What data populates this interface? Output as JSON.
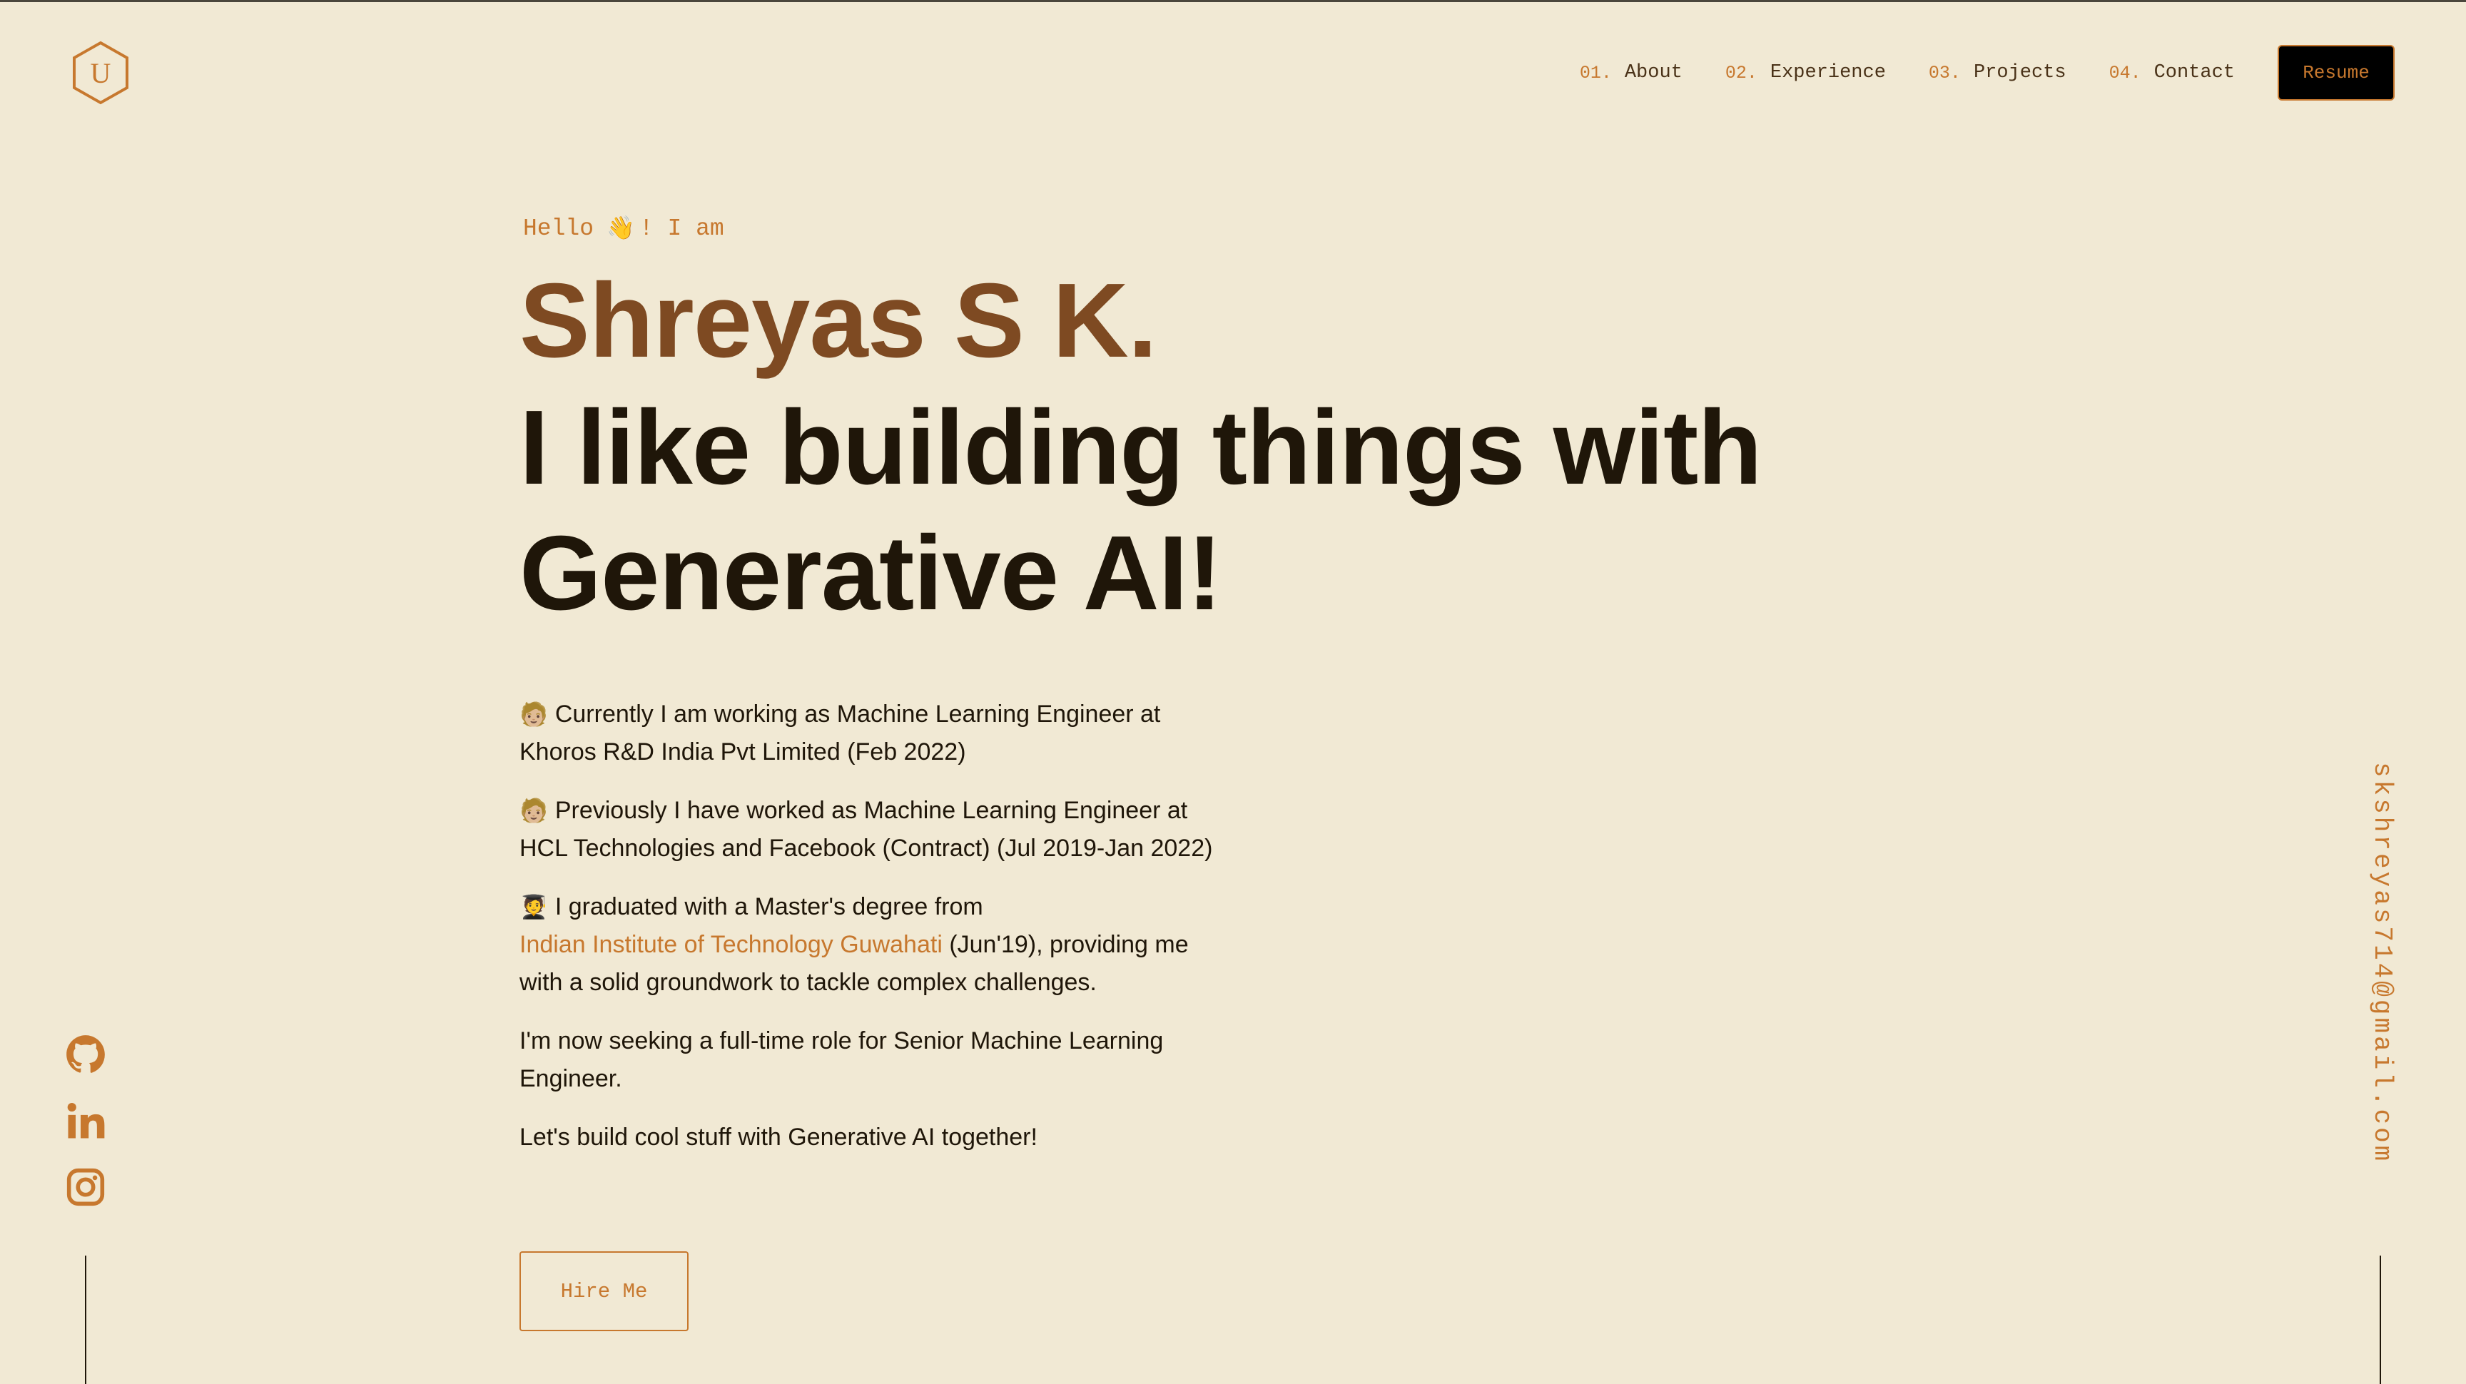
{
  "logo": {
    "letter": "U"
  },
  "nav": {
    "items": [
      {
        "num": "01.",
        "label": "About"
      },
      {
        "num": "02.",
        "label": "Experience"
      },
      {
        "num": "03.",
        "label": "Projects"
      },
      {
        "num": "04.",
        "label": "Contact"
      }
    ],
    "resume_label": "Resume"
  },
  "hero": {
    "greeting_pre": "Hello",
    "wave_icon": "👋",
    "greeting_post": "! I am",
    "name": "Shreyas S K.",
    "tagline_line1": "I like building things with",
    "tagline_line2": "Generative AI!"
  },
  "bio": {
    "p1_emoji": "🧑🏼",
    "p1_line1": "Currently I am working as Machine Learning Engineer at",
    "p1_line2": "Khoros R&D India Pvt Limited (Feb 2022)",
    "p2_emoji": "🧑🏼",
    "p2_line1": "Previously I have worked as Machine Learning Engineer at",
    "p2_line2": "HCL Technologies and Facebook (Contract) (Jul 2019-Jan 2022)",
    "p3_emoji": "🧑‍🎓",
    "p3_line1": "I graduated with a Master's degree from",
    "p3_link": "Indian Institute of Technology Guwahati",
    "p3_after_link": " (Jun'19), providing me",
    "p3_line3": "with a solid groundwork to tackle complex challenges.",
    "p4_line1": "I'm now seeking a full-time role for Senior Machine Learning",
    "p4_line2": "Engineer.",
    "p5": "Let's build cool stuff with Generative AI together!"
  },
  "hire_label": "Hire Me",
  "social": {
    "icons": [
      "github-icon",
      "linkedin-icon",
      "instagram-icon"
    ]
  },
  "email": "skshreyas714@gmail.com",
  "colors": {
    "accent": "#c7782e",
    "name": "#7e4a22",
    "background": "#f1e9d4",
    "text": "#1f1609"
  }
}
